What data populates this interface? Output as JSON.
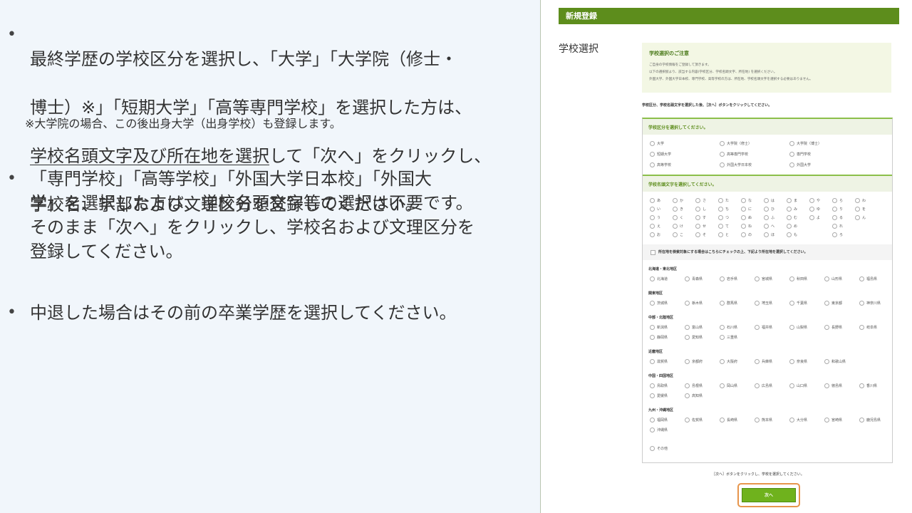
{
  "left": {
    "b1": {
      "l1": "最終学歴の学校区分を選択し、「大学」「大学院（修士・",
      "l2": "博士）※」「短期大学」「高等専門学校」を選択した方は、",
      "l3u": "学校名頭文字及び所在地を選択",
      "l3r": "して「次へ」をクリックし、",
      "l4": "学校名、学部および文理区分を登録してください。"
    },
    "note": "※大学院の場合、この後出身大学（出身学校）も登録します。",
    "b2": "「専門学校」「高等学校」「外国大学日本校」「外国大\n学」を選択した方は、学校名頭文字等の選択は不要です。\nそのまま「次へ」をクリックし、学校名および文理区分を\n登録してください。",
    "b3": "中退した場合はその前の卒業学歴を選択してください。",
    "bullet": "•"
  },
  "form": {
    "header": "新規登録",
    "side_label": "学校選択",
    "notice": {
      "title": "学校選択のご注意",
      "lines": [
        "ご自身の学校情報をご登録して頂きます。",
        "以下の選択肢より、該当する内容(学校区分、学校名頭文字、所在地) を選択ください。",
        "外国大学、外国大学日本校、専門学校、高等学校の方は、所在地、学校名頭文字を選択する必要はありません。"
      ]
    },
    "instruction": "学校区分、学校名頭文字を選択した後、［次へ］ボタンをクリックしてください。",
    "school_type": {
      "heading": "学校区分を選択してください。",
      "options": [
        "大学",
        "大学院（修士）",
        "大学院（博士）",
        "短期大学",
        "高等専門学校",
        "専門学校",
        "高等学校",
        "外国大学日本校",
        "外国大学"
      ]
    },
    "initial": {
      "heading": "学校名頭文字を選択してください。",
      "columns": [
        [
          "あ",
          "い",
          "う",
          "え",
          "お"
        ],
        [
          "か",
          "き",
          "く",
          "け",
          "こ"
        ],
        [
          "さ",
          "し",
          "す",
          "せ",
          "そ"
        ],
        [
          "た",
          "ち",
          "つ",
          "て",
          "と"
        ],
        [
          "な",
          "に",
          "ぬ",
          "ね",
          "の"
        ],
        [
          "は",
          "ひ",
          "ふ",
          "へ",
          "ほ"
        ],
        [
          "ま",
          "み",
          "む",
          "め",
          "も"
        ],
        [
          "や",
          "ゆ",
          "よ",
          "",
          ""
        ],
        [
          "ら",
          "り",
          "る",
          "れ",
          "ろ"
        ],
        [
          "わ",
          "を",
          "ん",
          "",
          ""
        ]
      ]
    },
    "location_check": "所在地を検索対象にする場合はこちらにチェックの上、下記より所在地を選択してください。",
    "regions": [
      {
        "name": "北海道・東北地区",
        "prefs": [
          "北海道",
          "青森県",
          "岩手県",
          "宮城県",
          "秋田県",
          "山形県",
          "福島県"
        ]
      },
      {
        "name": "関東地区",
        "prefs": [
          "茨城県",
          "栃木県",
          "群馬県",
          "埼玉県",
          "千葉県",
          "東京都",
          "神奈川県"
        ]
      },
      {
        "name": "中部・北陸地区",
        "prefs": [
          "新潟県",
          "富山県",
          "石川県",
          "福井県",
          "山梨県",
          "長野県",
          "岐阜県",
          "静岡県",
          "愛知県",
          "三重県"
        ]
      },
      {
        "name": "近畿地区",
        "prefs": [
          "滋賀県",
          "京都府",
          "大阪府",
          "兵庫県",
          "奈良県",
          "和歌山県"
        ]
      },
      {
        "name": "中国・四国地区",
        "prefs": [
          "鳥取県",
          "島根県",
          "岡山県",
          "広島県",
          "山口県",
          "徳島県",
          "香川県",
          "愛媛県",
          "高知県"
        ]
      },
      {
        "name": "九州・沖縄地区",
        "prefs": [
          "福岡県",
          "佐賀県",
          "長崎県",
          "熊本県",
          "大分県",
          "宮崎県",
          "鹿児島県",
          "沖縄県"
        ]
      },
      {
        "name": "",
        "prefs": [
          "その他"
        ]
      }
    ],
    "bottom_instruction": "［次へ］ボタンをクリックし、学校を選択してください。",
    "next_button": "次へ",
    "colors": {
      "header": "#5d8d1c",
      "accent": "#8bbf4a",
      "button": "#6fb21d",
      "highlight": "#e7954b"
    }
  }
}
